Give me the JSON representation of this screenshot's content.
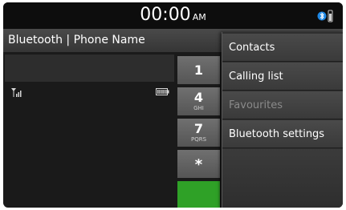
{
  "status_bar": {
    "time": "00:00",
    "ampm": "AM",
    "icons": [
      "bluetooth-icon",
      "phone-battery-icon"
    ]
  },
  "header": {
    "title": "Bluetooth | Phone Name"
  },
  "dial": {
    "number": "",
    "status_icons": [
      "signal-strength-icon",
      "battery-icon"
    ]
  },
  "keypad": {
    "keys": [
      {
        "num": "1",
        "letters": ""
      },
      {
        "num": "4",
        "letters": "GHI"
      },
      {
        "num": "7",
        "letters": "PQRS"
      },
      {
        "num": "*",
        "letters": ""
      }
    ],
    "call_color": "#2fa127"
  },
  "menu": {
    "items": [
      {
        "label": "Contacts",
        "enabled": true
      },
      {
        "label": "Calling list",
        "enabled": true
      },
      {
        "label": "Favourites",
        "enabled": false
      },
      {
        "label": "Bluetooth settings",
        "enabled": true
      }
    ]
  }
}
